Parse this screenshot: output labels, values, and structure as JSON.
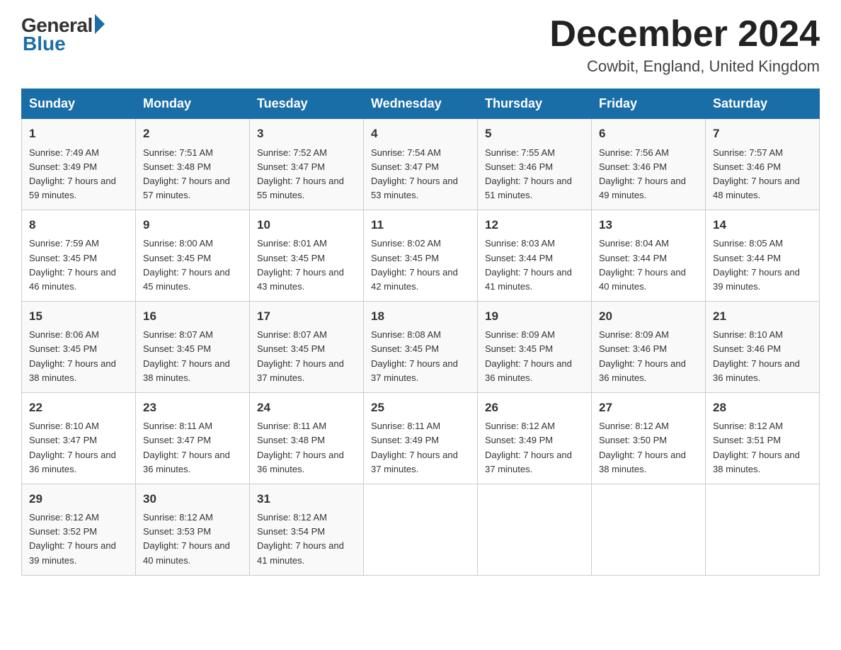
{
  "header": {
    "logo_general": "General",
    "logo_blue": "Blue",
    "month_title": "December 2024",
    "location": "Cowbit, England, United Kingdom"
  },
  "days_of_week": [
    "Sunday",
    "Monday",
    "Tuesday",
    "Wednesday",
    "Thursday",
    "Friday",
    "Saturday"
  ],
  "weeks": [
    [
      {
        "day": "1",
        "sunrise": "7:49 AM",
        "sunset": "3:49 PM",
        "daylight": "7 hours and 59 minutes."
      },
      {
        "day": "2",
        "sunrise": "7:51 AM",
        "sunset": "3:48 PM",
        "daylight": "7 hours and 57 minutes."
      },
      {
        "day": "3",
        "sunrise": "7:52 AM",
        "sunset": "3:47 PM",
        "daylight": "7 hours and 55 minutes."
      },
      {
        "day": "4",
        "sunrise": "7:54 AM",
        "sunset": "3:47 PM",
        "daylight": "7 hours and 53 minutes."
      },
      {
        "day": "5",
        "sunrise": "7:55 AM",
        "sunset": "3:46 PM",
        "daylight": "7 hours and 51 minutes."
      },
      {
        "day": "6",
        "sunrise": "7:56 AM",
        "sunset": "3:46 PM",
        "daylight": "7 hours and 49 minutes."
      },
      {
        "day": "7",
        "sunrise": "7:57 AM",
        "sunset": "3:46 PM",
        "daylight": "7 hours and 48 minutes."
      }
    ],
    [
      {
        "day": "8",
        "sunrise": "7:59 AM",
        "sunset": "3:45 PM",
        "daylight": "7 hours and 46 minutes."
      },
      {
        "day": "9",
        "sunrise": "8:00 AM",
        "sunset": "3:45 PM",
        "daylight": "7 hours and 45 minutes."
      },
      {
        "day": "10",
        "sunrise": "8:01 AM",
        "sunset": "3:45 PM",
        "daylight": "7 hours and 43 minutes."
      },
      {
        "day": "11",
        "sunrise": "8:02 AM",
        "sunset": "3:45 PM",
        "daylight": "7 hours and 42 minutes."
      },
      {
        "day": "12",
        "sunrise": "8:03 AM",
        "sunset": "3:44 PM",
        "daylight": "7 hours and 41 minutes."
      },
      {
        "day": "13",
        "sunrise": "8:04 AM",
        "sunset": "3:44 PM",
        "daylight": "7 hours and 40 minutes."
      },
      {
        "day": "14",
        "sunrise": "8:05 AM",
        "sunset": "3:44 PM",
        "daylight": "7 hours and 39 minutes."
      }
    ],
    [
      {
        "day": "15",
        "sunrise": "8:06 AM",
        "sunset": "3:45 PM",
        "daylight": "7 hours and 38 minutes."
      },
      {
        "day": "16",
        "sunrise": "8:07 AM",
        "sunset": "3:45 PM",
        "daylight": "7 hours and 38 minutes."
      },
      {
        "day": "17",
        "sunrise": "8:07 AM",
        "sunset": "3:45 PM",
        "daylight": "7 hours and 37 minutes."
      },
      {
        "day": "18",
        "sunrise": "8:08 AM",
        "sunset": "3:45 PM",
        "daylight": "7 hours and 37 minutes."
      },
      {
        "day": "19",
        "sunrise": "8:09 AM",
        "sunset": "3:45 PM",
        "daylight": "7 hours and 36 minutes."
      },
      {
        "day": "20",
        "sunrise": "8:09 AM",
        "sunset": "3:46 PM",
        "daylight": "7 hours and 36 minutes."
      },
      {
        "day": "21",
        "sunrise": "8:10 AM",
        "sunset": "3:46 PM",
        "daylight": "7 hours and 36 minutes."
      }
    ],
    [
      {
        "day": "22",
        "sunrise": "8:10 AM",
        "sunset": "3:47 PM",
        "daylight": "7 hours and 36 minutes."
      },
      {
        "day": "23",
        "sunrise": "8:11 AM",
        "sunset": "3:47 PM",
        "daylight": "7 hours and 36 minutes."
      },
      {
        "day": "24",
        "sunrise": "8:11 AM",
        "sunset": "3:48 PM",
        "daylight": "7 hours and 36 minutes."
      },
      {
        "day": "25",
        "sunrise": "8:11 AM",
        "sunset": "3:49 PM",
        "daylight": "7 hours and 37 minutes."
      },
      {
        "day": "26",
        "sunrise": "8:12 AM",
        "sunset": "3:49 PM",
        "daylight": "7 hours and 37 minutes."
      },
      {
        "day": "27",
        "sunrise": "8:12 AM",
        "sunset": "3:50 PM",
        "daylight": "7 hours and 38 minutes."
      },
      {
        "day": "28",
        "sunrise": "8:12 AM",
        "sunset": "3:51 PM",
        "daylight": "7 hours and 38 minutes."
      }
    ],
    [
      {
        "day": "29",
        "sunrise": "8:12 AM",
        "sunset": "3:52 PM",
        "daylight": "7 hours and 39 minutes."
      },
      {
        "day": "30",
        "sunrise": "8:12 AM",
        "sunset": "3:53 PM",
        "daylight": "7 hours and 40 minutes."
      },
      {
        "day": "31",
        "sunrise": "8:12 AM",
        "sunset": "3:54 PM",
        "daylight": "7 hours and 41 minutes."
      },
      null,
      null,
      null,
      null
    ]
  ]
}
